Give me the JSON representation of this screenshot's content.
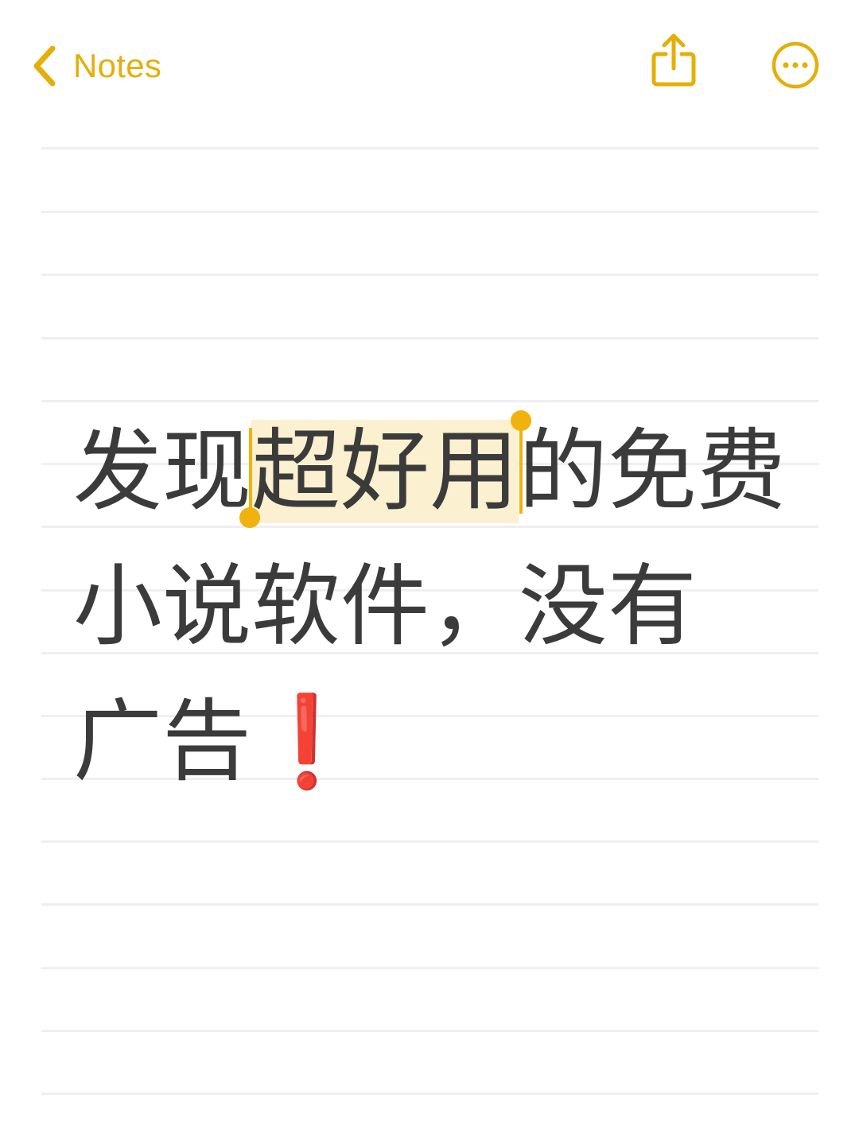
{
  "nav": {
    "back_label": "Notes",
    "back_icon": "chevron-left-icon",
    "share_icon": "share-icon",
    "more_icon": "more-icon"
  },
  "note": {
    "line1_before": "发现",
    "line1_selected": "超好用",
    "line1_after": "的免费",
    "line2": "小说软件，没有",
    "line3_text": "广告",
    "line3_emoji": "❗"
  },
  "colors": {
    "accent": "#E4AF0A",
    "text": "#3B3B3B",
    "selection": "#FBF0CF",
    "rule": "#EFEFEF",
    "emoji": "#E02020"
  }
}
